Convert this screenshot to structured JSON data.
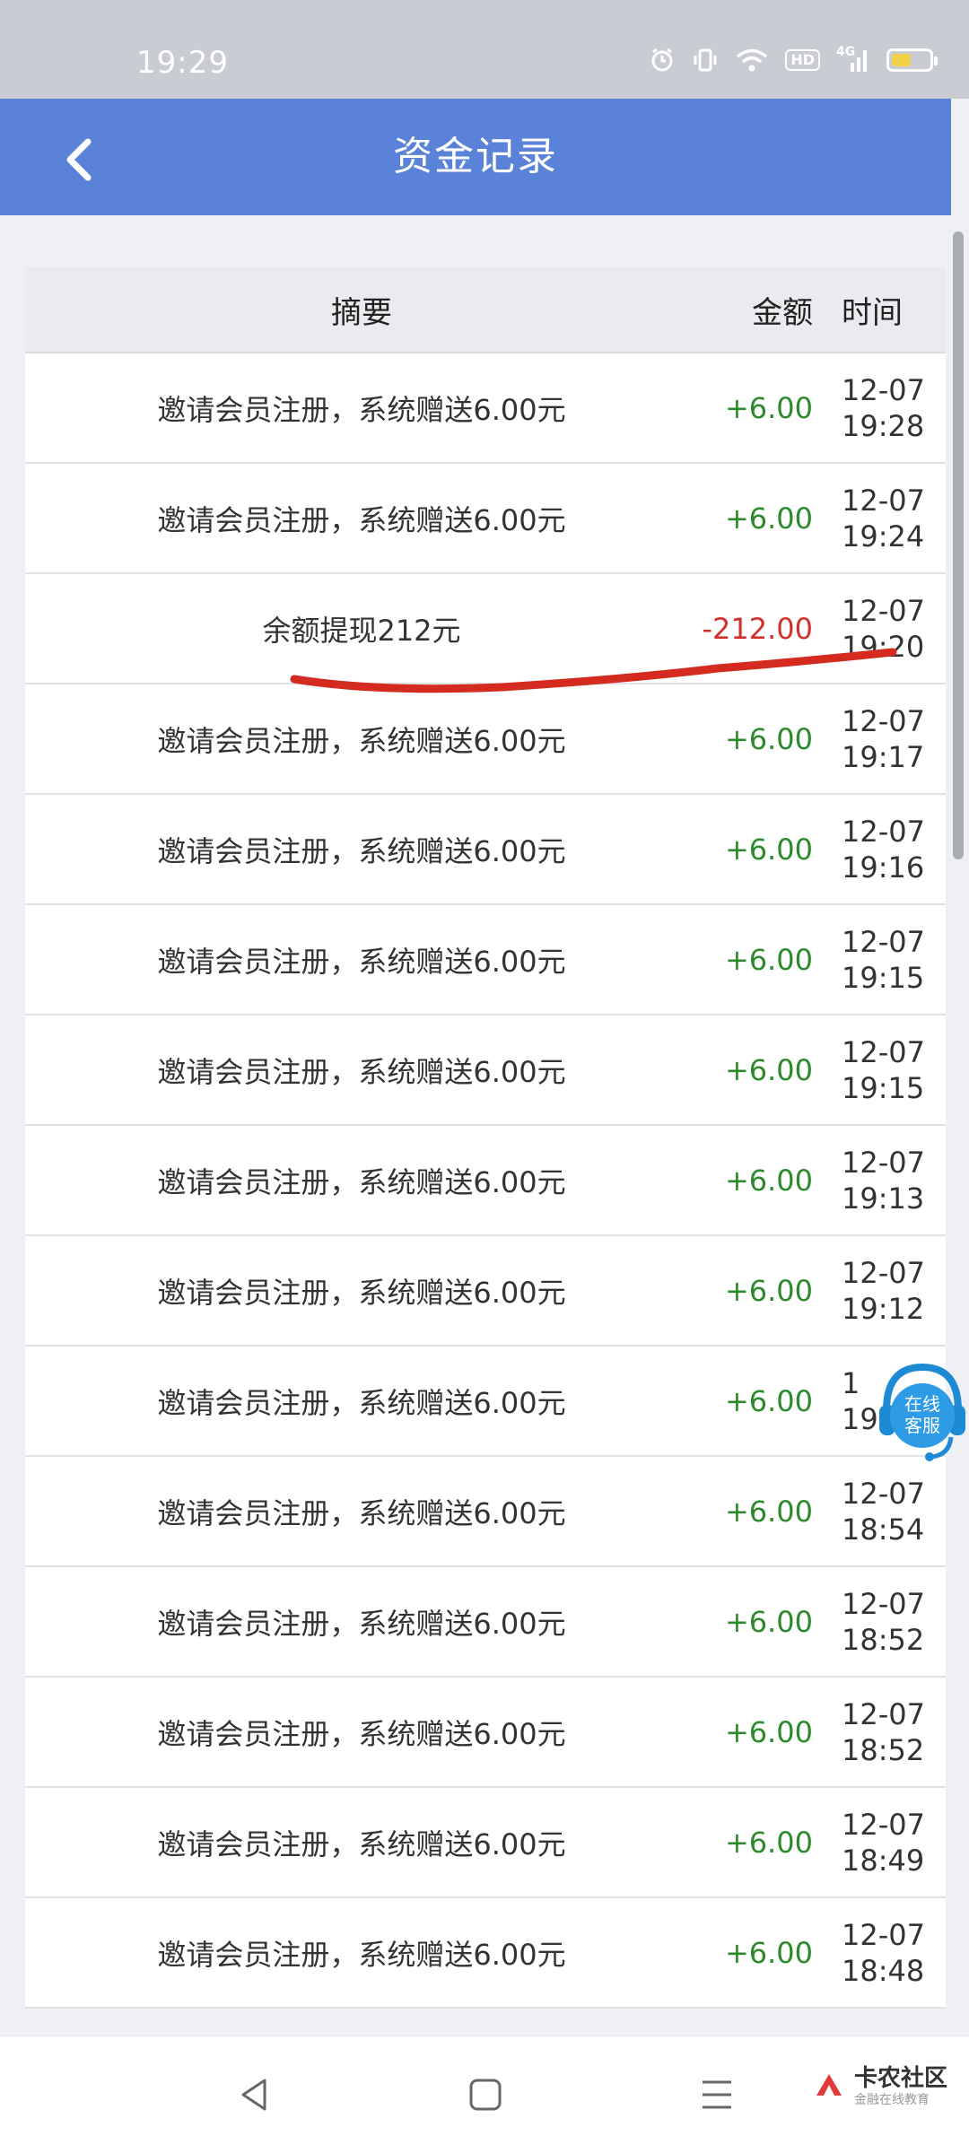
{
  "status_bar": {
    "time": "19:29",
    "icons": [
      "alarm-icon",
      "vibrate-icon",
      "wifi-icon",
      "hd-badge",
      "signal-4g-icon",
      "battery-icon"
    ],
    "hd_label": "HD",
    "network_label": "4G",
    "battery_fill_color": "#f1d24a"
  },
  "app_bar": {
    "title": "资金记录",
    "background": "#5b82d9"
  },
  "table": {
    "headers": {
      "summary": "摘要",
      "amount": "金额",
      "time": "时间"
    },
    "rows": [
      {
        "summary": "邀请会员注册，系统赠送6.00元",
        "amount": "+6.00",
        "type": "positive",
        "date": "12-07",
        "time": "19:28"
      },
      {
        "summary": "邀请会员注册，系统赠送6.00元",
        "amount": "+6.00",
        "type": "positive",
        "date": "12-07",
        "time": "19:24"
      },
      {
        "summary": "余额提现212元",
        "amount": "-212.00",
        "type": "negative",
        "date": "12-07",
        "time": "19:20"
      },
      {
        "summary": "邀请会员注册，系统赠送6.00元",
        "amount": "+6.00",
        "type": "positive",
        "date": "12-07",
        "time": "19:17"
      },
      {
        "summary": "邀请会员注册，系统赠送6.00元",
        "amount": "+6.00",
        "type": "positive",
        "date": "12-07",
        "time": "19:16"
      },
      {
        "summary": "邀请会员注册，系统赠送6.00元",
        "amount": "+6.00",
        "type": "positive",
        "date": "12-07",
        "time": "19:15"
      },
      {
        "summary": "邀请会员注册，系统赠送6.00元",
        "amount": "+6.00",
        "type": "positive",
        "date": "12-07",
        "time": "19:15"
      },
      {
        "summary": "邀请会员注册，系统赠送6.00元",
        "amount": "+6.00",
        "type": "positive",
        "date": "12-07",
        "time": "19:13"
      },
      {
        "summary": "邀请会员注册，系统赠送6.00元",
        "amount": "+6.00",
        "type": "positive",
        "date": "12-07",
        "time": "19:12"
      },
      {
        "summary": "邀请会员注册，系统赠送6.00元",
        "amount": "+6.00",
        "type": "positive",
        "date": "1",
        "time": "19"
      },
      {
        "summary": "邀请会员注册，系统赠送6.00元",
        "amount": "+6.00",
        "type": "positive",
        "date": "12-07",
        "time": "18:54"
      },
      {
        "summary": "邀请会员注册，系统赠送6.00元",
        "amount": "+6.00",
        "type": "positive",
        "date": "12-07",
        "time": "18:52"
      },
      {
        "summary": "邀请会员注册，系统赠送6.00元",
        "amount": "+6.00",
        "type": "positive",
        "date": "12-07",
        "time": "18:52"
      },
      {
        "summary": "邀请会员注册，系统赠送6.00元",
        "amount": "+6.00",
        "type": "positive",
        "date": "12-07",
        "time": "18:49"
      },
      {
        "summary": "邀请会员注册，系统赠送6.00元",
        "amount": "+6.00",
        "type": "positive",
        "date": "12-07",
        "time": "18:48"
      }
    ],
    "colors": {
      "positive": "#2c8a2c",
      "negative": "#d0312d"
    }
  },
  "floating_service": {
    "label_line1": "在线",
    "label_line2": "客服",
    "color": "#1d8ad6"
  },
  "annotation": {
    "type": "red-underline",
    "color": "#d42a1f"
  },
  "nav_bar": {
    "buttons": [
      "back-triangle-icon",
      "home-square-icon",
      "menu-lines-icon"
    ]
  },
  "watermark": {
    "main": "卡农社区",
    "sub": "金融在线教育"
  }
}
